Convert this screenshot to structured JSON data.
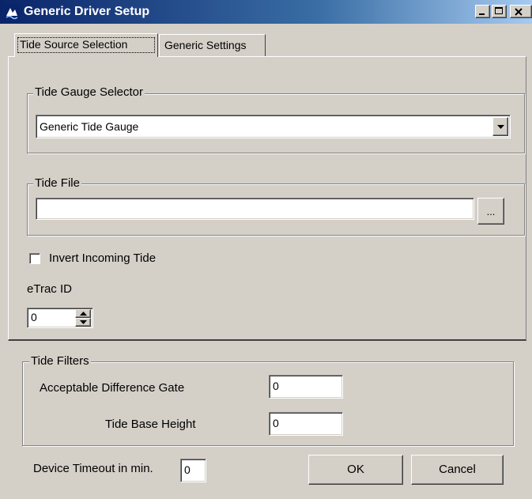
{
  "window": {
    "title": "Generic Driver Setup",
    "caption_buttons": [
      "minimize",
      "maximize",
      "close"
    ]
  },
  "tabs": [
    {
      "label": "Tide Source Selection",
      "selected": true
    },
    {
      "label": "Generic Settings",
      "selected": false
    }
  ],
  "tide_gauge": {
    "legend": "Tide Gauge Selector",
    "selected": "Generic Tide Gauge"
  },
  "tide_file": {
    "legend": "Tide File",
    "value": "",
    "browse_label": "..."
  },
  "invert": {
    "label": "Invert Incoming Tide",
    "checked": false
  },
  "etrac": {
    "label": "eTrac ID",
    "value": "0"
  },
  "filters": {
    "legend": "Tide Filters",
    "difference_gate_label": "Acceptable Difference Gate",
    "difference_gate_value": "0",
    "base_height_label": "Tide Base Height",
    "base_height_value": "0"
  },
  "footer": {
    "timeout_label": "Device Timeout in min.",
    "timeout_value": "0",
    "ok_label": "OK",
    "cancel_label": "Cancel"
  },
  "colors": {
    "face": "#d4d0c8",
    "titlebar_start": "#0a246a",
    "titlebar_end": "#a6caf0"
  }
}
